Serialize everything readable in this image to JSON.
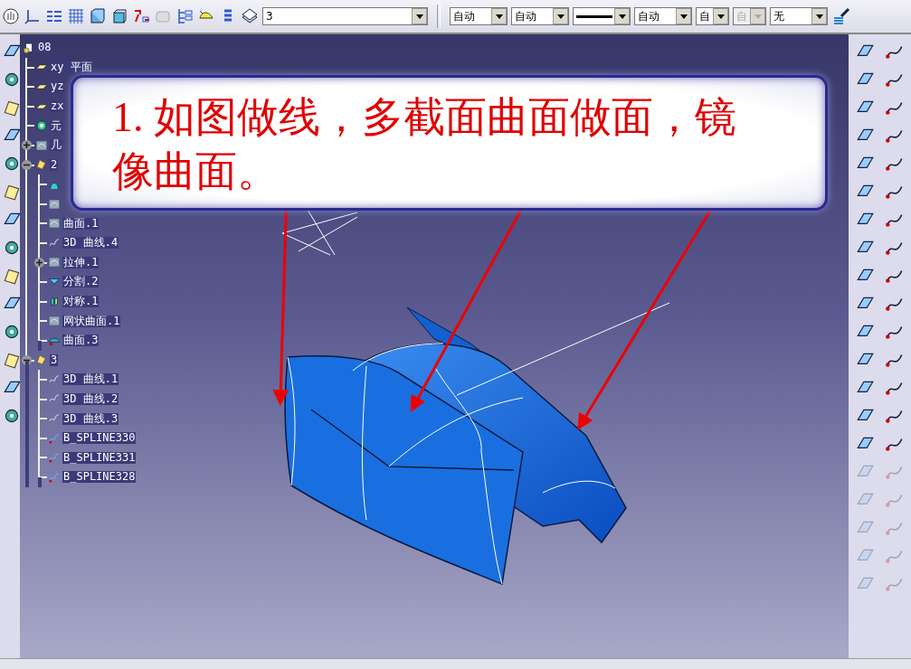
{
  "toolbar": {
    "combos": [
      {
        "kind": "text",
        "value": "3",
        "disabled": false
      },
      {
        "kind": "text",
        "value": "自动",
        "disabled": false
      },
      {
        "kind": "text",
        "value": "自动",
        "disabled": false
      },
      {
        "kind": "line",
        "disabled": false
      },
      {
        "kind": "text",
        "value": "自动",
        "disabled": false
      },
      {
        "kind": "text",
        "value": "自",
        "disabled": false
      },
      {
        "kind": "text",
        "value": "自",
        "disabled": true
      },
      {
        "kind": "text",
        "value": "无",
        "disabled": false
      }
    ]
  },
  "tree": {
    "kind": "part",
    "label": "08",
    "children": [
      {
        "kind": "plane",
        "label": "xy 平面"
      },
      {
        "kind": "plane",
        "label": "yz"
      },
      {
        "kind": "plane",
        "label": "zx"
      },
      {
        "kind": "axis",
        "label": "元"
      },
      {
        "kind": "body",
        "label": "几",
        "expanded": false
      },
      {
        "kind": "geoset",
        "label": "2",
        "expanded": true,
        "children": [
          {
            "kind": "sweep"
          },
          {
            "kind": "body"
          },
          {
            "kind": "body",
            "label": "曲面.1"
          },
          {
            "kind": "curve",
            "label": "3D 曲线.4"
          },
          {
            "kind": "body",
            "label": "拉伸.1",
            "expanded": false
          },
          {
            "kind": "split",
            "label": "分割.2"
          },
          {
            "kind": "symmetry",
            "label": "对称.1"
          },
          {
            "kind": "body",
            "label": "网状曲面.1"
          },
          {
            "kind": "fill",
            "label": "曲面.3"
          }
        ]
      },
      {
        "kind": "geoset",
        "label": "3",
        "expanded": true,
        "children": [
          {
            "kind": "curve",
            "label": "3D 曲线.1"
          },
          {
            "kind": "curve",
            "label": "3D 曲线.2"
          },
          {
            "kind": "curve",
            "label": "3D 曲线.3"
          },
          {
            "kind": "spline",
            "label": "B_SPLINE330"
          },
          {
            "kind": "spline",
            "label": "B_SPLINE331"
          },
          {
            "kind": "spline",
            "label": "B_SPLINE328"
          }
        ]
      }
    ]
  },
  "callout": {
    "text": "1. 如图做线，多截面曲面做面，镜像曲面。"
  }
}
